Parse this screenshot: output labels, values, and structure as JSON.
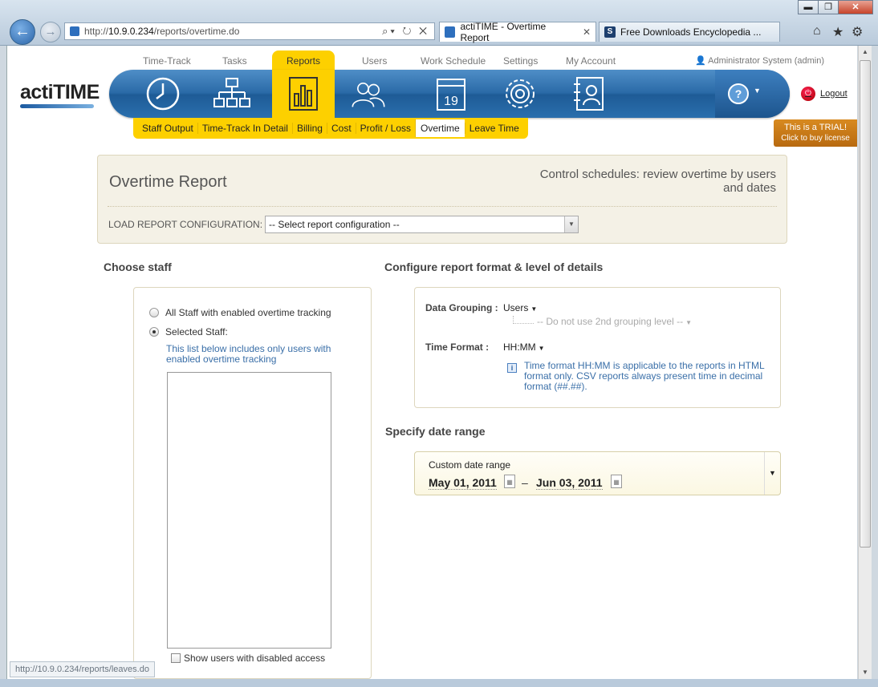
{
  "browser": {
    "window_controls": {
      "minimize": "▬",
      "maximize": "❐",
      "close": "✕"
    },
    "address": {
      "url_prefix": "http://",
      "host": "10.9.0.234",
      "path": "/reports/overtime.do",
      "actions": "⌕▾ ↻ ✕"
    },
    "tabs": [
      {
        "label": "actiTIME - Overtime Report",
        "icon": "page-icon",
        "close": "✕"
      },
      {
        "label": "Free Downloads Encyclopedia ...",
        "icon": "softpedia-icon"
      }
    ],
    "right_icons": {
      "home": "⌂",
      "favorites": "★",
      "tools": "⚙"
    },
    "status_url": "http://10.9.0.234/reports/leaves.do"
  },
  "app": {
    "logo": "actiTIME",
    "top_nav": [
      "Time-Track",
      "Tasks",
      "Reports",
      "Users",
      "Work Schedule",
      "Settings",
      "My Account"
    ],
    "active_nav": "Reports",
    "user": "Administrator System (admin)",
    "logout": "Logout",
    "trial": {
      "line1": "This is a TRIAL!",
      "line2": "Click to buy license"
    },
    "sub_nav": [
      "Staff Output",
      "Time-Track In Detail",
      "Billing",
      "Cost",
      "Profit / Loss",
      "Overtime",
      "Leave Time"
    ],
    "active_sub": "Overtime",
    "help_icon": "?",
    "icons": [
      "clock-icon",
      "tasks-tree-icon",
      "reports-chart-icon",
      "users-icon",
      "calendar-icon",
      "settings-gear-icon",
      "account-card-icon"
    ],
    "calendar_day": "19"
  },
  "header": {
    "title": "Overtime Report",
    "tagline": "Control schedules: review overtime by users and dates",
    "load_label": "LOAD REPORT CONFIGURATION:",
    "load_select": "-- Select report configuration --"
  },
  "staff": {
    "section_title": "Choose staff",
    "option_all": "All Staff with enabled overtime tracking",
    "option_selected": "Selected Staff:",
    "selected_option": "Selected Staff:",
    "note": "This list below includes only users with enabled overtime tracking",
    "show_disabled": "Show users with disabled access"
  },
  "format": {
    "section_title": "Configure report format & level of details",
    "grouping_label": "Data Grouping :",
    "grouping_value": "Users",
    "second_level": "-- Do not use 2nd grouping level --",
    "time_format_label": "Time Format :",
    "time_format_value": "HH:MM",
    "info": "Time format HH:MM is applicable to the reports in HTML format only. CSV reports always present time in decimal format (##.##)."
  },
  "dates": {
    "section_title": "Specify date range",
    "range_label": "Custom date range",
    "from": "May 01, 2011",
    "separator": "–",
    "to": "Jun 03, 2011"
  },
  "colors": {
    "accent_yellow": "#fdd000",
    "bar_blue": "#2a6aa7",
    "trial_orange": "#c87818",
    "link_blue": "#3a6fa8"
  }
}
